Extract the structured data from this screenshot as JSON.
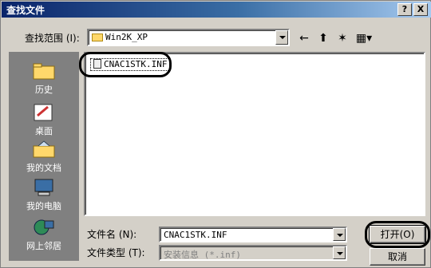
{
  "window": {
    "title": "查找文件",
    "help": "?",
    "close": "X"
  },
  "lookin": {
    "label": "查找范围 (I):",
    "value": "Win2K_XP"
  },
  "toolbar": {
    "back": "←",
    "up": "⬆",
    "newfolder": "✶",
    "views": "▦▾"
  },
  "places": [
    {
      "label": "历史",
      "icon": "history-icon"
    },
    {
      "label": "桌面",
      "icon": "desktop-icon"
    },
    {
      "label": "我的文档",
      "icon": "my-documents-icon"
    },
    {
      "label": "我的电脑",
      "icon": "my-computer-icon"
    },
    {
      "label": "网上邻居",
      "icon": "network-icon"
    }
  ],
  "files": [
    {
      "name": "CNAC1STK.INF"
    }
  ],
  "filename": {
    "label": "文件名 (N):",
    "value": "CNAC1STK.INF"
  },
  "filetype": {
    "label": "文件类型 (T):",
    "value": "安装信息 (*.inf)"
  },
  "buttons": {
    "open": "打开(O)",
    "cancel": "取消"
  }
}
